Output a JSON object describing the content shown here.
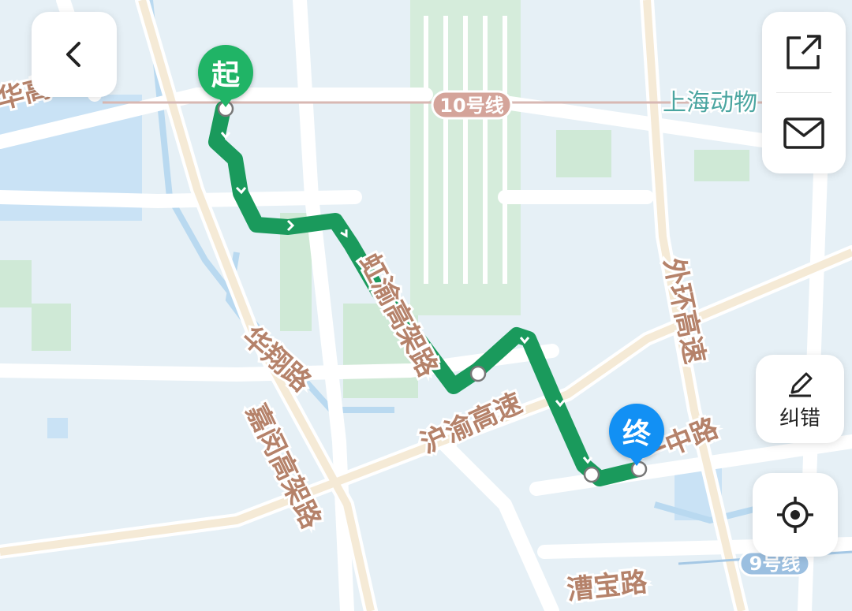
{
  "map": {
    "colors": {
      "background": "#e6f0f6",
      "water": "#c9e2f5",
      "green": "#cfe9d6",
      "road": "#ffffff",
      "route": "#1a9a5c",
      "start": "#20b466",
      "end": "#1290f4",
      "label": "#b5826a",
      "poi": "#4aa5a0"
    },
    "labels": {
      "hongyu_elevated": "虹渝高架路",
      "huaxiang_road": "华翔路",
      "jiamin_elevated": "嘉闵高架路",
      "huyu_expressway": "沪渝高速",
      "outer_ring": "外环高速",
      "caobao_road": "漕宝路",
      "yizhong_road": "一中路",
      "left_edge_fragment": "华高",
      "zoo": "上海动物",
      "metro_10": "10号线",
      "metro_9": "9号线"
    },
    "route": {
      "start_label": "起",
      "end_label": "终"
    }
  },
  "controls": {
    "back_icon": "chevron-left-icon",
    "share_icon": "share-external-icon",
    "mail_icon": "envelope-icon",
    "report_icon": "pencil-icon",
    "report_label": "纠错",
    "locate_icon": "locate-target-icon"
  }
}
